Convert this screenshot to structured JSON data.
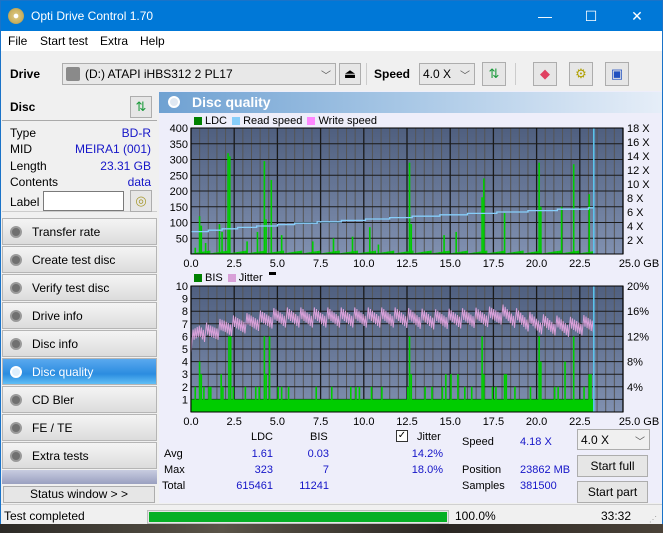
{
  "window": {
    "title": "Opti Drive Control 1.70",
    "minimize": "—",
    "maximize": "☐",
    "close": "✕"
  },
  "menu": [
    "File",
    "Start test",
    "Extra",
    "Help"
  ],
  "toolbar": {
    "drive_label": "Drive",
    "drive_value": "(D:)  ATAPI iHBS312  2 PL17",
    "speed_label": "Speed",
    "speed_value": "4.0 X"
  },
  "disc": {
    "header": "Disc",
    "fields": [
      {
        "key": "Type",
        "value": "BD-R"
      },
      {
        "key": "MID",
        "value": "MEIRA1 (001)"
      },
      {
        "key": "Length",
        "value": "23.31 GB"
      },
      {
        "key": "Contents",
        "value": "data"
      }
    ],
    "label_key": "Label",
    "label_value": ""
  },
  "nav": [
    {
      "label": "Transfer rate",
      "active": false
    },
    {
      "label": "Create test disc",
      "active": false
    },
    {
      "label": "Verify test disc",
      "active": false
    },
    {
      "label": "Drive info",
      "active": false
    },
    {
      "label": "Disc info",
      "active": false
    },
    {
      "label": "Disc quality",
      "active": true
    },
    {
      "label": "CD Bler",
      "active": false
    },
    {
      "label": "FE / TE",
      "active": false
    },
    {
      "label": "Extra tests",
      "active": false
    }
  ],
  "status_window_btn": "Status window > >",
  "panel": {
    "title": "Disc quality"
  },
  "colors": {
    "ldc": "#008000",
    "read_speed": "#87cefa",
    "write_speed": "#ff88ff",
    "bis": "#008000",
    "jitter": "#d8a0d8",
    "bar_green": "#00cc00",
    "plot_top": "#4f5f7f",
    "plot_bottom": "#8090b0",
    "accent": "#0078d7"
  },
  "chart_data": [
    {
      "type": "bar",
      "title": "LDC / Read speed",
      "legend": [
        "LDC",
        "Read speed",
        "Write speed"
      ],
      "xlabel": "GB",
      "x_ticks": [
        "0.0",
        "2.5",
        "5.0",
        "7.5",
        "10.0",
        "12.5",
        "15.0",
        "17.5",
        "20.0",
        "22.5",
        "25.0 GB"
      ],
      "xlim": [
        0,
        25
      ],
      "y_ticks": [
        "50",
        "100",
        "150",
        "200",
        "250",
        "300",
        "350",
        "400"
      ],
      "ylim": [
        0,
        400
      ],
      "y2_ticks": [
        "2 X",
        "4 X",
        "6 X",
        "8 X",
        "10 X",
        "12 X",
        "14 X",
        "16 X",
        "18 X"
      ],
      "y2lim": [
        0,
        18
      ],
      "end_marker_gb": 23.31,
      "ldc_spikes": [
        [
          0.2,
          20
        ],
        [
          0.45,
          120
        ],
        [
          0.55,
          90
        ],
        [
          0.8,
          35
        ],
        [
          1.6,
          95
        ],
        [
          1.75,
          70
        ],
        [
          2.1,
          320
        ],
        [
          2.2,
          310
        ],
        [
          3.2,
          40
        ],
        [
          3.8,
          70
        ],
        [
          4.2,
          295
        ],
        [
          4.3,
          110
        ],
        [
          4.6,
          235
        ],
        [
          5.2,
          60
        ],
        [
          7.0,
          40
        ],
        [
          8.2,
          50
        ],
        [
          9.3,
          55
        ],
        [
          10.3,
          85
        ],
        [
          10.8,
          30
        ],
        [
          12.6,
          290
        ],
        [
          12.7,
          95
        ],
        [
          14.6,
          60
        ],
        [
          15.3,
          70
        ],
        [
          16.8,
          180
        ],
        [
          16.9,
          240
        ],
        [
          18.1,
          130
        ],
        [
          20.1,
          290
        ],
        [
          20.2,
          150
        ],
        [
          21.4,
          150
        ],
        [
          22.1,
          285
        ],
        [
          23.0,
          190
        ]
      ],
      "read_speed_steps": [
        [
          0,
          3.2
        ],
        [
          1.0,
          3.4
        ],
        [
          1.8,
          3.6
        ],
        [
          2.7,
          3.8
        ],
        [
          3.8,
          4.0
        ],
        [
          5.0,
          4.2
        ],
        [
          6.0,
          4.4
        ],
        [
          7.3,
          4.6
        ],
        [
          8.7,
          4.8
        ],
        [
          10.1,
          5.0
        ],
        [
          11.5,
          5.2
        ],
        [
          12.8,
          5.4
        ],
        [
          14.4,
          5.6
        ],
        [
          16.0,
          5.8
        ],
        [
          17.7,
          6.0
        ],
        [
          19.5,
          6.2
        ],
        [
          21.2,
          6.4
        ],
        [
          23.0,
          6.6
        ],
        [
          23.31,
          6.6
        ]
      ]
    },
    {
      "type": "bar",
      "title": "BIS / Jitter",
      "legend": [
        "BIS",
        "Jitter"
      ],
      "xlabel": "GB",
      "x_ticks": [
        "0.0",
        "2.5",
        "5.0",
        "7.5",
        "10.0",
        "12.5",
        "15.0",
        "17.5",
        "20.0",
        "22.5",
        "25.0 GB"
      ],
      "xlim": [
        0,
        25
      ],
      "y_ticks": [
        "1",
        "2",
        "3",
        "4",
        "5",
        "6",
        "7",
        "8",
        "9",
        "10"
      ],
      "ylim": [
        0,
        10
      ],
      "y2_ticks": [
        "4%",
        "8%",
        "12%",
        "16%",
        "20%"
      ],
      "y2lim": [
        0,
        20
      ],
      "bis_baseline": 1,
      "bis_spikes": [
        [
          0.2,
          2
        ],
        [
          0.45,
          4
        ],
        [
          0.55,
          3
        ],
        [
          0.7,
          2
        ],
        [
          1.0,
          2
        ],
        [
          1.1,
          2
        ],
        [
          1.7,
          3
        ],
        [
          1.8,
          2
        ],
        [
          2.15,
          6
        ],
        [
          2.25,
          6
        ],
        [
          2.4,
          2
        ],
        [
          3.1,
          2
        ],
        [
          3.7,
          2
        ],
        [
          3.9,
          2
        ],
        [
          4.2,
          6
        ],
        [
          4.3,
          3
        ],
        [
          4.5,
          6
        ],
        [
          5.0,
          2
        ],
        [
          5.2,
          2
        ],
        [
          5.6,
          2
        ],
        [
          7.2,
          2
        ],
        [
          8.1,
          2
        ],
        [
          9.2,
          2
        ],
        [
          9.5,
          2
        ],
        [
          9.7,
          2
        ],
        [
          10.4,
          2
        ],
        [
          11.0,
          2
        ],
        [
          12.5,
          2
        ],
        [
          12.6,
          6
        ],
        [
          12.7,
          3
        ],
        [
          13.5,
          2
        ],
        [
          13.9,
          2
        ],
        [
          14.5,
          2
        ],
        [
          14.7,
          3
        ],
        [
          15.0,
          3
        ],
        [
          15.4,
          3
        ],
        [
          15.8,
          2
        ],
        [
          16.2,
          2
        ],
        [
          16.8,
          6
        ],
        [
          16.9,
          3
        ],
        [
          17.4,
          2
        ],
        [
          17.6,
          2
        ],
        [
          18.1,
          3
        ],
        [
          18.2,
          3
        ],
        [
          18.7,
          2
        ],
        [
          19.6,
          2
        ],
        [
          20.1,
          6
        ],
        [
          20.2,
          4
        ],
        [
          21.0,
          2
        ],
        [
          21.2,
          2
        ],
        [
          21.6,
          4
        ],
        [
          22.1,
          6
        ],
        [
          22.7,
          2
        ],
        [
          23.0,
          3
        ],
        [
          23.1,
          3
        ]
      ],
      "jitter_avg_pct": 14.2,
      "jitter_max_pct": 18.0,
      "jitter_profile": [
        [
          0,
          11
        ],
        [
          0.5,
          13
        ],
        [
          1,
          12.5
        ],
        [
          2,
          13.5
        ],
        [
          3,
          14
        ],
        [
          4,
          14.5
        ],
        [
          5,
          15
        ],
        [
          7,
          15
        ],
        [
          10,
          15
        ],
        [
          12,
          15
        ],
        [
          14,
          14.7
        ],
        [
          17,
          15
        ],
        [
          18,
          15.5
        ],
        [
          20,
          14
        ],
        [
          22,
          13.5
        ],
        [
          23.31,
          14
        ]
      ],
      "end_marker_gb": 23.31
    }
  ],
  "stats": {
    "col_ldc": "LDC",
    "col_bis": "BIS",
    "rows": [
      {
        "label": "Avg",
        "ldc": "1.61",
        "bis": "0.03",
        "jitter": "14.2%"
      },
      {
        "label": "Max",
        "ldc": "323",
        "bis": "7",
        "jitter": "18.0%"
      },
      {
        "label": "Total",
        "ldc": "615461",
        "bis": "11241",
        "jitter": ""
      }
    ],
    "jitter_label": "Jitter",
    "jitter_checked": true,
    "speed_label": "Speed",
    "speed_value": "4.18 X",
    "position_label": "Position",
    "position_value": "23862 MB",
    "samples_label": "Samples",
    "samples_value": "381500",
    "speed_select": "4.0 X",
    "start_full": "Start full",
    "start_part": "Start part"
  },
  "statusbar": {
    "text": "Test completed",
    "progress_pct": 100,
    "progress_text": "100.0%",
    "time": "33:32"
  }
}
